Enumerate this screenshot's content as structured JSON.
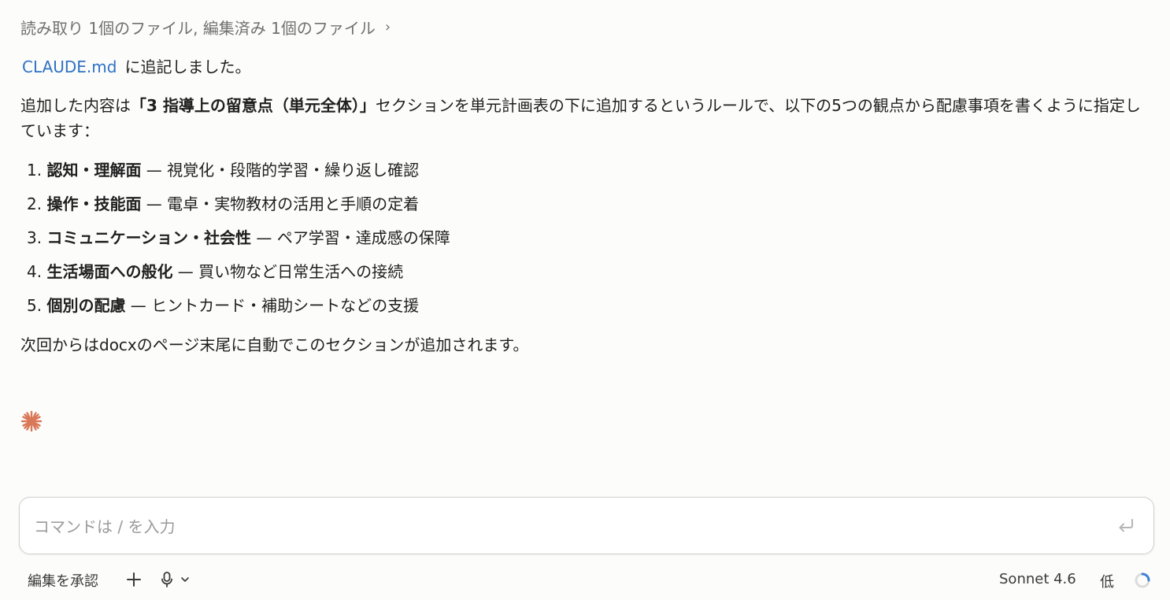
{
  "tool_summary": {
    "text": "読み取り 1個のファイル, 編集済み 1個のファイル",
    "chevron": "›"
  },
  "message": {
    "file_link": "CLAUDE.md",
    "added_text": "に追記しました。",
    "content_prefix": "追加した内容は",
    "content_bold": "「3 指導上の留意点（単元全体）」",
    "content_suffix": "セクションを単元計画表の下に追加するというルールで、以下の5つの観点から配慮事項を書くように指定しています：",
    "items": [
      {
        "num": "1.",
        "bold": "認知・理解面",
        "rest": " — 視覚化・段階的学習・繰り返し確認"
      },
      {
        "num": "2.",
        "bold": "操作・技能面",
        "rest": " — 電卓・実物教材の活用と手順の定着"
      },
      {
        "num": "3.",
        "bold": "コミュニケーション・社会性",
        "rest": " — ペア学習・達成感の保障"
      },
      {
        "num": "4.",
        "bold": "生活場面への般化",
        "rest": " — 買い物など日常生活への接続"
      },
      {
        "num": "5.",
        "bold": "個別の配慮",
        "rest": " — ヒントカード・補助シートなどの支援"
      }
    ],
    "next_text": "次回からはdocxのページ末尾に自動でこのセクションが追加されます。"
  },
  "input": {
    "placeholder": "コマンドは / を入力",
    "value": ""
  },
  "footer": {
    "accept_edits": "編集を承認",
    "model": "Sonnet 4.6",
    "effort": "低"
  },
  "colors": {
    "accent_link": "#2f72c4",
    "spark": "#d97757",
    "ring_progress": "#3b82d6"
  },
  "icons": [
    "chevron-right-icon",
    "spark-icon",
    "enter-icon",
    "plus-icon",
    "microphone-icon",
    "chevron-down-icon",
    "usage-ring-icon"
  ]
}
